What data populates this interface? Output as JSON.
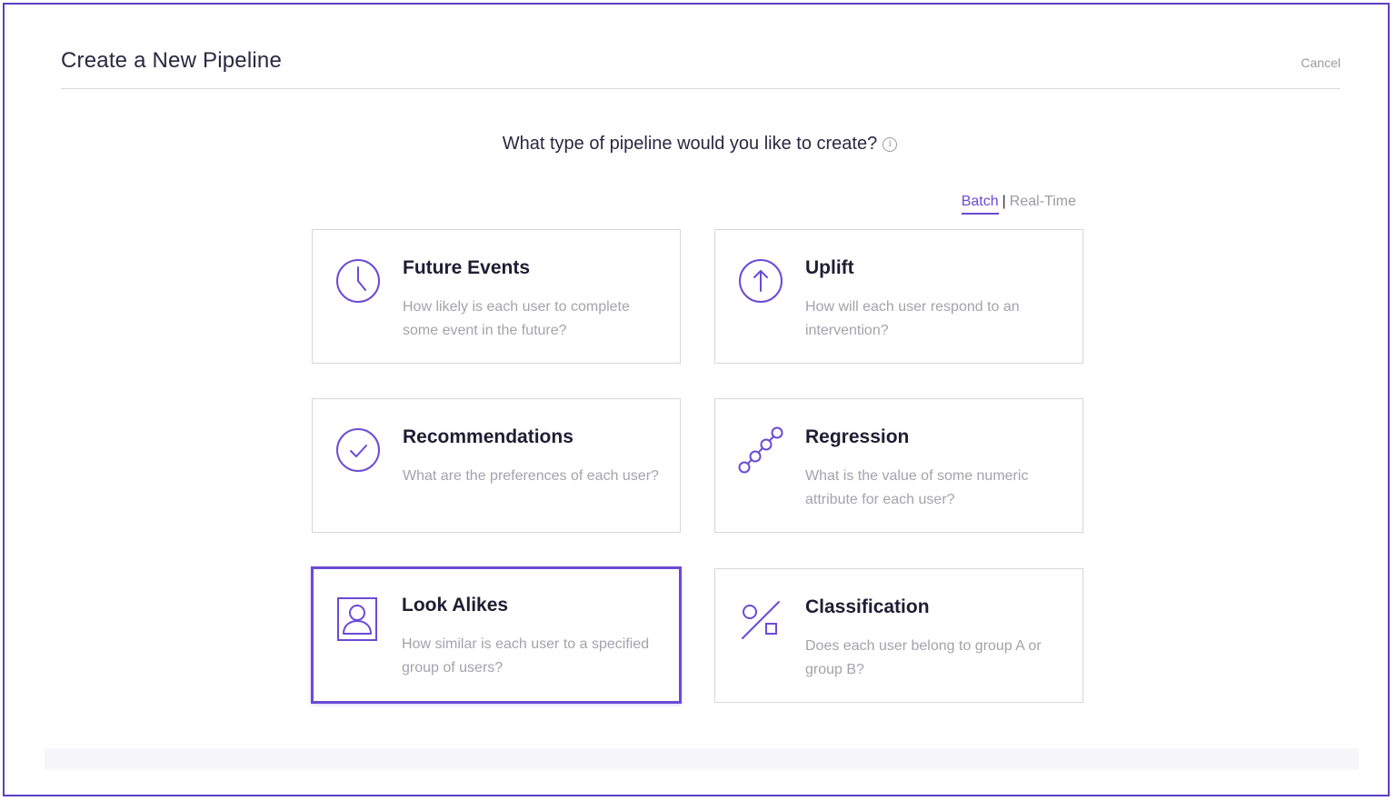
{
  "header": {
    "title": "Create a New Pipeline",
    "cancel_label": "Cancel"
  },
  "question": {
    "text": "What type of pipeline would you like to create?",
    "info_icon": "info-icon",
    "info_glyph": "i"
  },
  "mode": {
    "options": [
      "Batch",
      "Real-Time"
    ],
    "selected": "Batch",
    "separator": "|"
  },
  "cards": [
    {
      "title": "Future Events",
      "description": "How likely is each user to complete some event in the future?",
      "icon": "clock-icon",
      "selected": false
    },
    {
      "title": "Uplift",
      "description": "How will each user respond to an intervention?",
      "icon": "arrow-up-circle-icon",
      "selected": false
    },
    {
      "title": "Recommendations",
      "description": "What are the preferences of each user?",
      "icon": "check-circle-icon",
      "selected": false
    },
    {
      "title": "Regression",
      "description": "What is the value of some numeric attribute for each user?",
      "icon": "regression-icon",
      "selected": false
    },
    {
      "title": "Look Alikes",
      "description": "How similar is each user to a specified group of users?",
      "icon": "user-profile-icon",
      "selected": true
    },
    {
      "title": "Classification",
      "description": "Does each user belong to group A or group B?",
      "icon": "classification-icon",
      "selected": false
    }
  ],
  "colors": {
    "accent": "#6a4bd6",
    "border": "#5b3fc4",
    "text": "#2a2840",
    "muted": "#a3a3ab"
  }
}
